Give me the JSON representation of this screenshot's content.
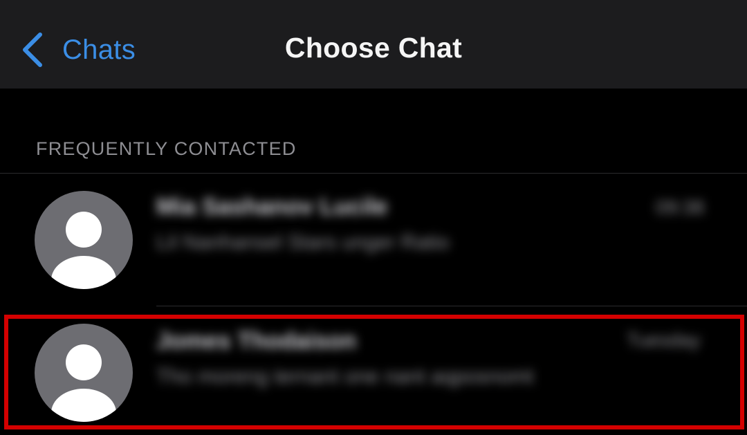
{
  "navbar": {
    "back_label": "Chats",
    "title": "Choose Chat"
  },
  "section": {
    "header": "FREQUENTLY CONTACTED"
  },
  "chats": [
    {
      "name": "Mia Sashanov Lucile",
      "preview": "Lil Nanhansel Stars unger Ratio",
      "time": "09:38"
    },
    {
      "name": "Jomes Thodaison",
      "preview": "Tho moreng ternant one nant aqposnomt",
      "time": "Tuesday"
    }
  ],
  "colors": {
    "accent": "#3b8ee6",
    "navbar_bg": "#1c1c1e",
    "highlight": "#d40000"
  }
}
